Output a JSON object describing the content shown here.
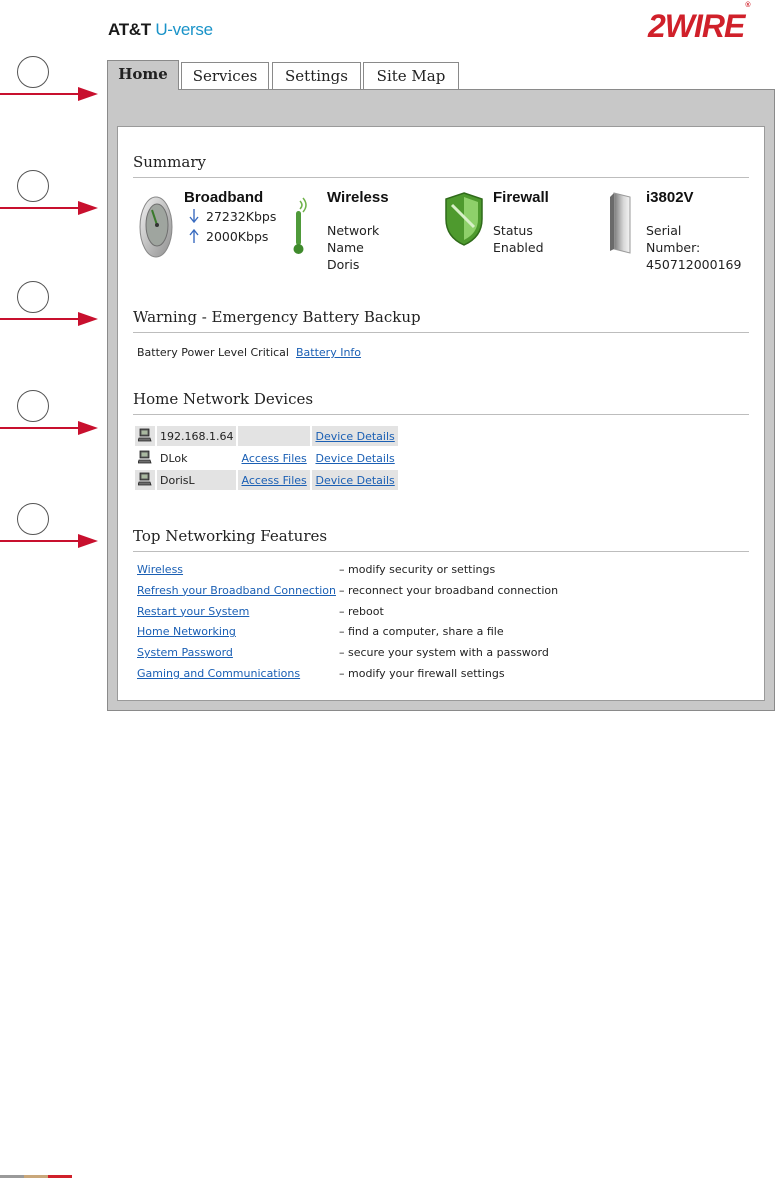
{
  "brand": {
    "att": "AT&T",
    "uverse": "U-verse"
  },
  "logo": {
    "text": "2WIRE",
    "reg": "®"
  },
  "callouts": [
    "",
    "",
    "",
    "",
    ""
  ],
  "tabs": [
    {
      "label": "Home",
      "active": true
    },
    {
      "label": "Services",
      "active": false
    },
    {
      "label": "Settings",
      "active": false
    },
    {
      "label": "Site Map",
      "active": false
    }
  ],
  "summary": {
    "title": "Summary",
    "broadband": {
      "title": "Broadband",
      "down": "27232Kbps",
      "up": "2000Kbps"
    },
    "wireless": {
      "title": "Wireless",
      "l1": "Network",
      "l2": "Name",
      "l3": "Doris"
    },
    "firewall": {
      "title": "Firewall",
      "l1": "Status",
      "l2": "Enabled"
    },
    "device": {
      "title": "i3802V",
      "l1": "Serial",
      "l2": "Number:",
      "l3": "450712000169"
    }
  },
  "warning": {
    "title": "Warning - Emergency Battery Backup",
    "text": "Battery Power Level Critical",
    "link": "Battery Info"
  },
  "devices": {
    "title": "Home Network Devices",
    "rows": [
      {
        "name": "192.168.1.64",
        "access": "",
        "details": "Device Details"
      },
      {
        "name": "DLok",
        "access": "Access Files",
        "details": "Device Details"
      },
      {
        "name": "DorisL",
        "access": "Access Files",
        "details": "Device Details"
      }
    ]
  },
  "features": {
    "title": "Top Networking Features",
    "items": [
      {
        "link": "Wireless",
        "desc": "– modify security or settings"
      },
      {
        "link": "Refresh your Broadband Connection",
        "desc": "– reconnect your broadband connection"
      },
      {
        "link": "Restart your System",
        "desc": "– reboot"
      },
      {
        "link": "Home Networking",
        "desc": "– find a computer, share a file"
      },
      {
        "link": "System Password",
        "desc": "– secure your system with a password"
      },
      {
        "link": "Gaming and Communications",
        "desc": "– modify your firewall settings"
      }
    ]
  },
  "colors": {
    "accent_link": "#1a5fb4",
    "brand_red": "#d0202a",
    "brand_blue": "#1a93c8",
    "frame_gray": "#c8c8c8",
    "arrow_red": "#c8102e"
  },
  "icons": {
    "broadband": "gauge-icon",
    "down_arrow": "arrow-down-icon",
    "up_arrow": "arrow-up-icon",
    "wireless": "antenna-icon",
    "firewall": "shield-icon",
    "device": "gateway-icon",
    "computer": "computer-icon"
  }
}
